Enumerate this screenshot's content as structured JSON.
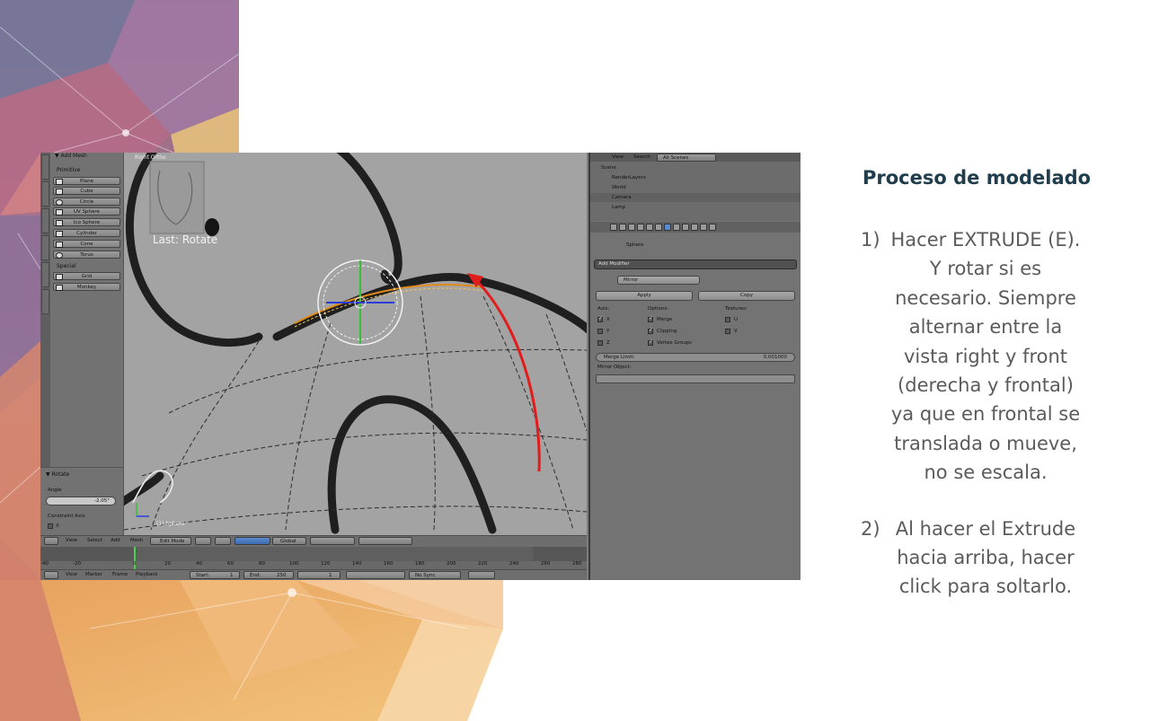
{
  "slide": {
    "title": "Proceso de modelado",
    "steps": [
      {
        "num": "1)",
        "text": "Hacer EXTRUDE (E). Y rotar si es necesario. Siempre alternar entre la vista right y front (derecha y frontal) ya que en frontal se translada o mueve, no se escala."
      },
      {
        "num": "2)",
        "text": "Al hacer el Extrude hacia arriba, hacer click para soltarlo."
      }
    ]
  },
  "blender": {
    "toolshelf": {
      "header": "▼ Add Mesh",
      "section_primitive": "Primitive",
      "primitives": [
        "Plane",
        "Cube",
        "Circle",
        "UV Sphere",
        "Ico Sphere",
        "Cylinder",
        "Cone",
        "Torus"
      ],
      "section_special": "Special",
      "special": [
        "Grid",
        "Monkey"
      ]
    },
    "viewport": {
      "view_name": "Right Ortho",
      "last_operator": "Last: Rotate",
      "object_label": "(1) Sphere"
    },
    "operator_panel": {
      "header": "▼ Rotate",
      "angle_label": "Angle",
      "angle_value": "-2.05°",
      "constraint_label": "Constraint Axis",
      "axis_x": "X"
    },
    "outliner": {
      "menu": [
        "View",
        "Search"
      ],
      "scope": "All Scenes",
      "rows": [
        "Scene",
        "RenderLayers",
        "World",
        "Camera",
        "Lamp"
      ]
    },
    "properties": {
      "object_name": "Sphere",
      "add_modifier": "Add Modifier",
      "modifier_name": "Mirror",
      "apply": "Apply",
      "copy": "Copy",
      "col_axis": "Axis:",
      "col_options": "Options:",
      "col_texture": "Textures:",
      "axes": [
        "X",
        "Y",
        "Z"
      ],
      "options": [
        "Merge",
        "Clipping",
        "Vertex Groups"
      ],
      "textures": [
        "U",
        "V"
      ],
      "merge_limit_label": "Merge Limit:",
      "merge_limit_value": "0.001000",
      "mirror_object_label": "Mirror Object:"
    },
    "header3d": {
      "items": [
        "View",
        "Select",
        "Add",
        "Mesh"
      ],
      "mode": "Edit Mode",
      "pivot": "Global"
    },
    "timeline": {
      "ticks": [
        "-40",
        "-20",
        "0",
        "20",
        "40",
        "60",
        "80",
        "100",
        "120",
        "140",
        "160",
        "180",
        "200",
        "220",
        "240",
        "260",
        "280"
      ],
      "menu": [
        "View",
        "Marker",
        "Frame",
        "Playback"
      ],
      "start": "Start:",
      "start_value": "1",
      "end": "End:",
      "end_value": "250",
      "current": "1",
      "sync": "No Sync"
    }
  }
}
